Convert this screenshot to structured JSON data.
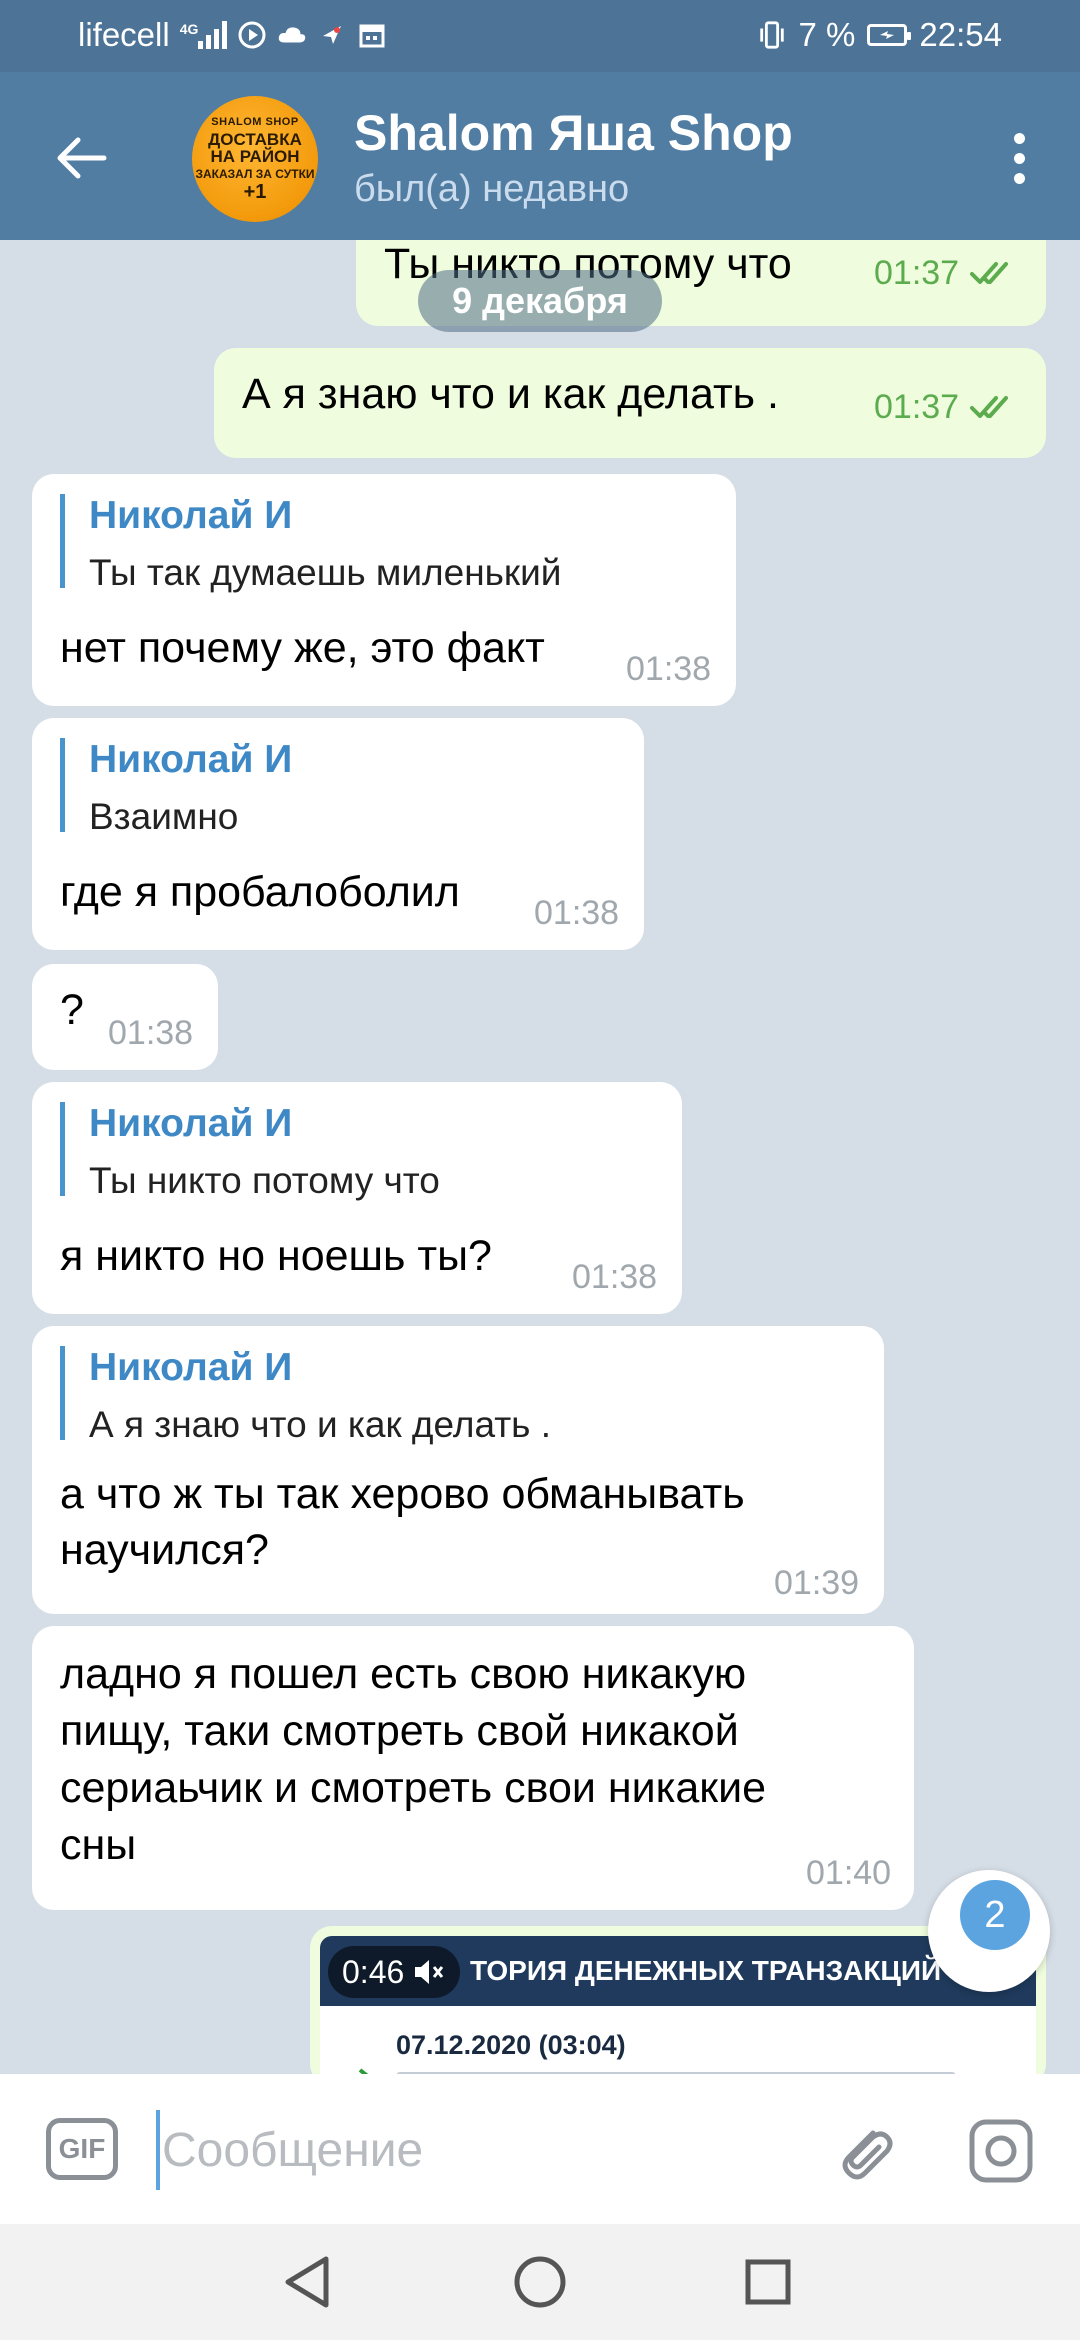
{
  "status_bar": {
    "carrier": "lifecell",
    "network": "4G",
    "battery": "7 %",
    "clock": "22:54"
  },
  "header": {
    "title": "Shalom Яша Shop",
    "subtitle": "был(а) недавно",
    "avatar_text": [
      "SHALOM SHOP",
      "ДОСТАВКА",
      "НА РАЙОН",
      "ЗАКАЗАЛ ЗА СУТКИ",
      "+1"
    ]
  },
  "chat": {
    "date_separator": "9 декабря",
    "messages": [
      {
        "dir": "out",
        "text": "Ты никто потому что",
        "time": "01:37",
        "read": true
      },
      {
        "dir": "out",
        "text": "А я знаю что и как делать .",
        "time": "01:37",
        "read": true
      },
      {
        "dir": "in",
        "reply_name": "Николай И",
        "reply_text": "Ты так думаешь миленький",
        "text": "нет почему же, это факт",
        "time": "01:38"
      },
      {
        "dir": "in",
        "reply_name": "Николай И",
        "reply_text": "Взаимно",
        "text": "где я пробалоболил",
        "time": "01:38"
      },
      {
        "dir": "in",
        "text": "?",
        "time": "01:38"
      },
      {
        "dir": "in",
        "reply_name": "Николай И",
        "reply_text": "Ты никто потому что",
        "text": "я никто но ноешь ты?",
        "time": "01:38"
      },
      {
        "dir": "in",
        "reply_name": "Николай И",
        "reply_text": "А я знаю что и как делать .",
        "text": "а что ж ты так херово обманывать\nнаучился?",
        "time": "01:39"
      },
      {
        "dir": "in",
        "text": "ладно я пошел есть свою никакую\nпищу, таки смотреть свой никакой\nсериаьчик и смотреть свои никакие\nсны",
        "time": "01:40"
      }
    ],
    "media": {
      "video_time": "0:46",
      "banner": "ИСТОРИЯ ДЕНЕЖНЫХ ТРАНЗАКЦИЙ",
      "visible_banner": "ТОРИЯ ДЕНЕЖНЫХ ТРАНЗАКЦИЙ",
      "entry_date": "07.12.2020 (03:04)"
    },
    "unread_badge": "2"
  },
  "composer": {
    "gif_label": "GIF",
    "placeholder": "Сообщение"
  },
  "colors": {
    "header": "#517da2",
    "statusbar": "#4d7396",
    "chat_bg": "#d5dde6",
    "incoming": "#ffffff",
    "outgoing": "#effdde",
    "reply_accent": "#3d88c5",
    "read_check": "#5cab4e"
  },
  "icons": [
    "back-arrow-icon",
    "more-vert-icon",
    "double-check-icon",
    "chevron-down-icon",
    "paperclip-icon",
    "camera-icon",
    "nav-back-icon",
    "nav-home-icon",
    "nav-recents-icon",
    "mute-icon"
  ]
}
